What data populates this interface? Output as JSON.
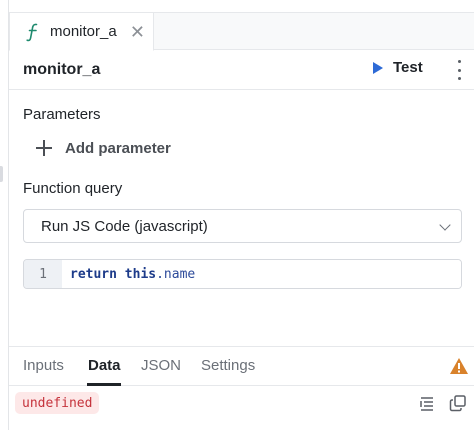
{
  "tab": {
    "icon": "function-icon",
    "label": "monitor_a",
    "close_icon": "close-icon"
  },
  "header": {
    "title": "monitor_a",
    "test_label": "Test"
  },
  "parameters": {
    "title": "Parameters",
    "add_label": "Add parameter"
  },
  "function_query": {
    "title": "Function query",
    "selected": "Run JS Code (javascript)"
  },
  "editor": {
    "line_number": "1",
    "code_return": "return",
    "code_this": "this",
    "code_rest": ".name"
  },
  "bottom_tabs": [
    "Inputs",
    "Data",
    "JSON",
    "Settings"
  ],
  "active_tab": "Data",
  "output": {
    "value": "undefined"
  },
  "colors": {
    "accent": "#2d6ad6",
    "function_icon": "#1f8a6e",
    "warning": "#d9822b",
    "error_text": "#c5323b"
  }
}
